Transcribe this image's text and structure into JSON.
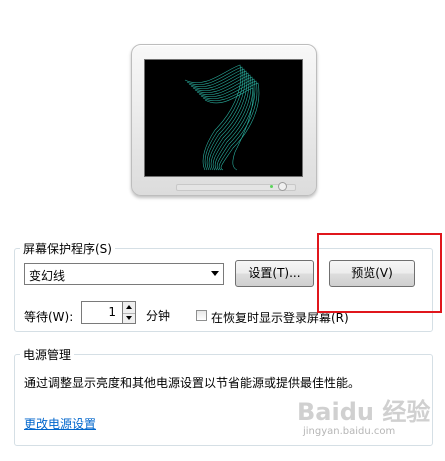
{
  "screensaver": {
    "group_title": "屏幕保护程序(S)",
    "selected": "变幻线",
    "settings_label": "设置(T)...",
    "preview_label": "预览(V)",
    "wait_label": "等待(W):",
    "wait_value": "1",
    "minutes_label": "分钟",
    "resume_checkbox_label": "在恢复时显示登录屏幕(R)",
    "resume_checked": false
  },
  "power": {
    "group_title": "电源管理",
    "description": "通过调整显示亮度和其他电源设置以节省能源或提供最佳性能。",
    "link_label": "更改电源设置"
  },
  "watermark": {
    "main": "Baidu 经验",
    "sub": "jingyan.baidu.com"
  },
  "colors": {
    "highlight": "#e0161c",
    "link": "#0066cc",
    "preview_wave": "#2fc2b0"
  },
  "icons": {
    "dropdown": "chevron-down-icon",
    "spin_up": "arrow-up-icon",
    "spin_down": "arrow-down-icon",
    "monitor": "monitor-icon",
    "watermark_logo": "baidu-paw-icon"
  }
}
